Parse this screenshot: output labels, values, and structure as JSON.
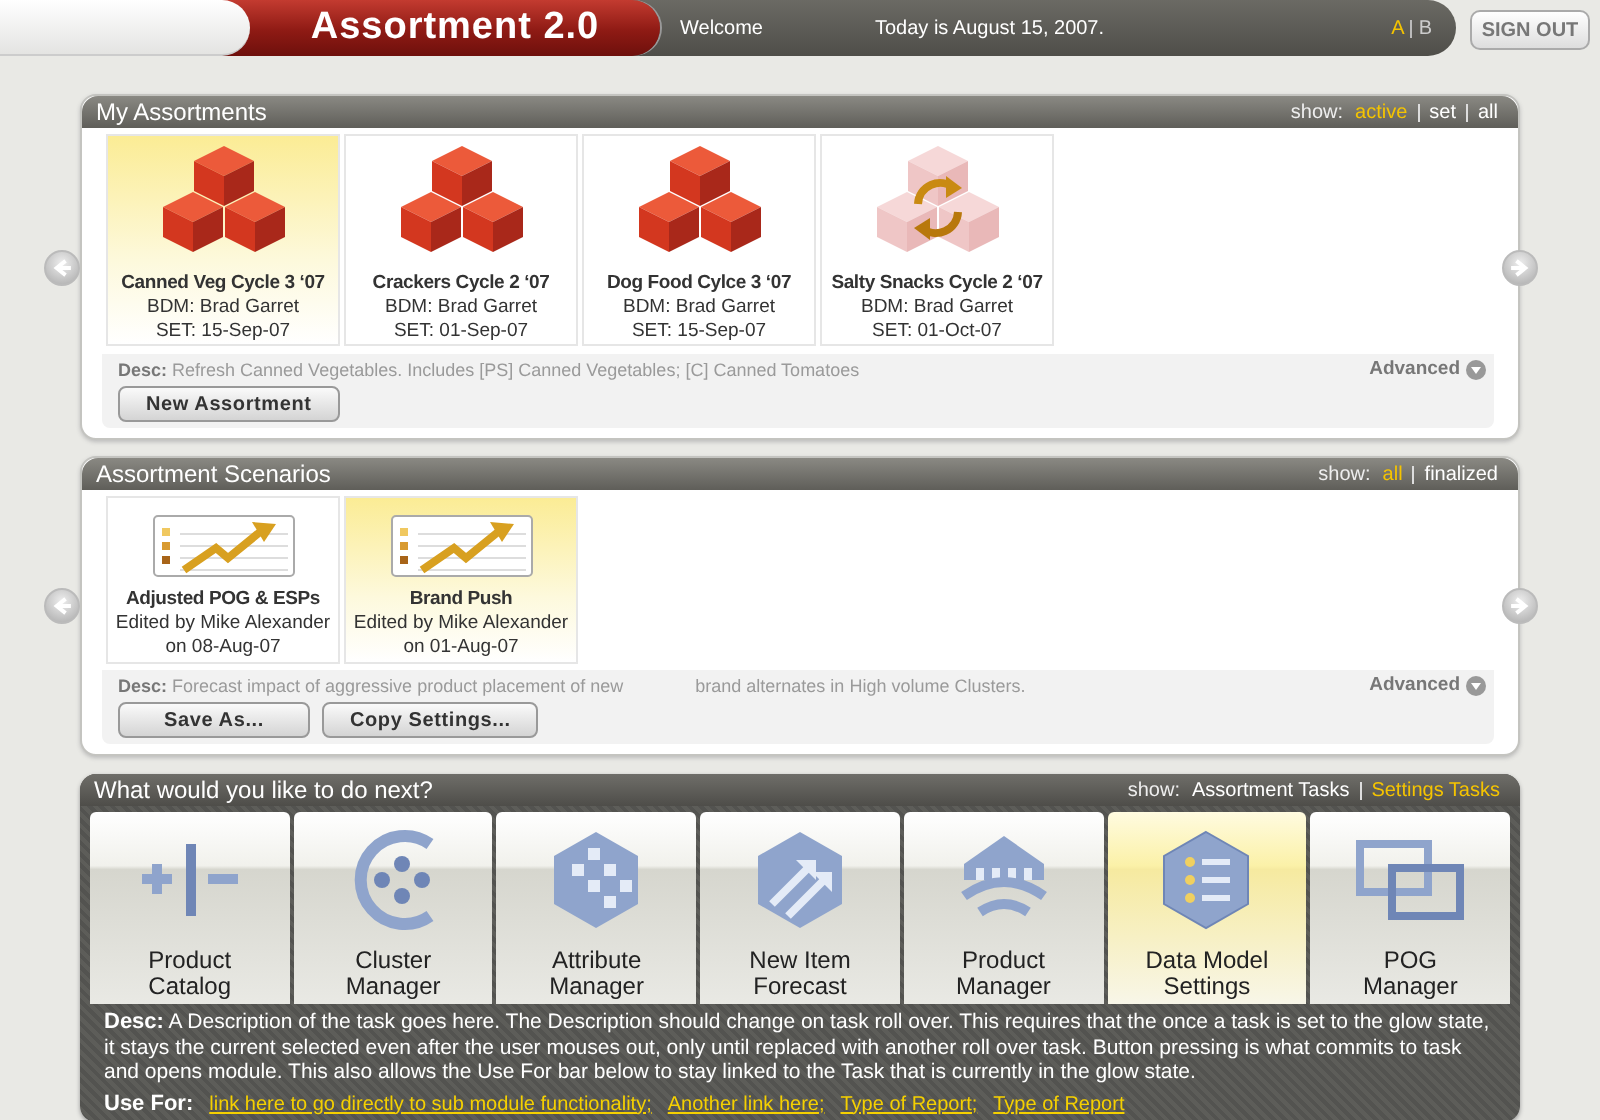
{
  "header": {
    "title": "Assortment 2.0",
    "welcome": "Welcome",
    "date": "Today is August 15, 2007.",
    "view_options": [
      {
        "label": "A",
        "selected": true
      },
      {
        "label": "B",
        "selected": false
      }
    ],
    "sign_out": "SIGN OUT"
  },
  "assortments": {
    "title": "My Assortments",
    "show_label": "show:",
    "filters": [
      {
        "label": "active",
        "selected": true
      },
      {
        "label": "set",
        "selected": false
      },
      {
        "label": "all",
        "selected": false
      }
    ],
    "items": [
      {
        "name": "Canned Veg Cycle 3 ‘07",
        "bdm": "BDM: Brad Garret",
        "set": "SET: 15-Sep-07",
        "kind": "cubes",
        "selected": true
      },
      {
        "name": "Crackers Cycle 2 ‘07",
        "bdm": "BDM: Brad Garret",
        "set": "SET: 01-Sep-07",
        "kind": "cubes",
        "selected": false
      },
      {
        "name": "Dog Food Cylce 3 ‘07",
        "bdm": "BDM: Brad Garret",
        "set": "SET: 15-Sep-07",
        "kind": "cubes",
        "selected": false
      },
      {
        "name": "Salty Snacks Cycle 2 ‘07",
        "bdm": "BDM: Brad Garret",
        "set": "SET: 01-Oct-07",
        "kind": "refresh",
        "selected": false
      }
    ],
    "desc": "**Desc:** Refresh Canned Vegetables. Includes [PS] Canned Vegetables; [C] Canned Tomatoes",
    "advanced": "Advanced",
    "buttons": [
      "New Assortment"
    ]
  },
  "scenarios": {
    "title": "Assortment Scenarios",
    "show_label": "show:",
    "filters": [
      {
        "label": "all",
        "selected": true
      },
      {
        "label": "finalized",
        "selected": false
      }
    ],
    "items": [
      {
        "name": "Adjusted POG & ESPs",
        "edited_by": "Edited by Mike Alexander",
        "date": "on 08-Aug-07",
        "selected": false
      },
      {
        "name": "Brand Push",
        "edited_by": "Edited by Mike Alexander",
        "date": "on 01-Aug-07",
        "selected": true
      }
    ],
    "desc": "**Desc:** Forecast impact of aggressive product placement of new",
    "desc_continued": "brand alternates in High volume Clusters.",
    "advanced": "Advanced",
    "buttons": [
      "Save As...",
      "Copy Settings..."
    ]
  },
  "tasks": {
    "title": "What would you like to do next?",
    "show_label": "show:",
    "filters": [
      {
        "label": "Assortment Tasks",
        "selected": false
      },
      {
        "label": "Settings Tasks",
        "selected": true
      }
    ],
    "items": [
      {
        "label": "Product\nCatalog",
        "kind": "catalog",
        "selected": false
      },
      {
        "label": "Cluster\nManager",
        "kind": "cluster",
        "selected": false
      },
      {
        "label": "Attribute\nManager",
        "kind": "attribute",
        "selected": false
      },
      {
        "label": "New Item\nForecast",
        "kind": "forecast",
        "selected": false
      },
      {
        "label": "Product\nManager",
        "kind": "product",
        "selected": false
      },
      {
        "label": "Data Model\nSettings",
        "kind": "datamodel",
        "selected": true
      },
      {
        "label": "POG\nManager",
        "kind": "pog",
        "selected": false
      }
    ],
    "desc": "**Desc:** A Description of the task goes here. The Description should change on task roll over. This requires that the once a task is set to the glow state, it stays the current selected even after the user mouses out, only until replaced with another roll over task. Button pressing is what commits to task and opens module. This also allows the Use For bar below to stay linked to the Task that is currently in the glow state.",
    "use_for_label": "Use For:",
    "links": [
      "link here to go directly to sub module functionality;",
      "Another link here;",
      "Type of Report;",
      "Type of Report"
    ]
  }
}
